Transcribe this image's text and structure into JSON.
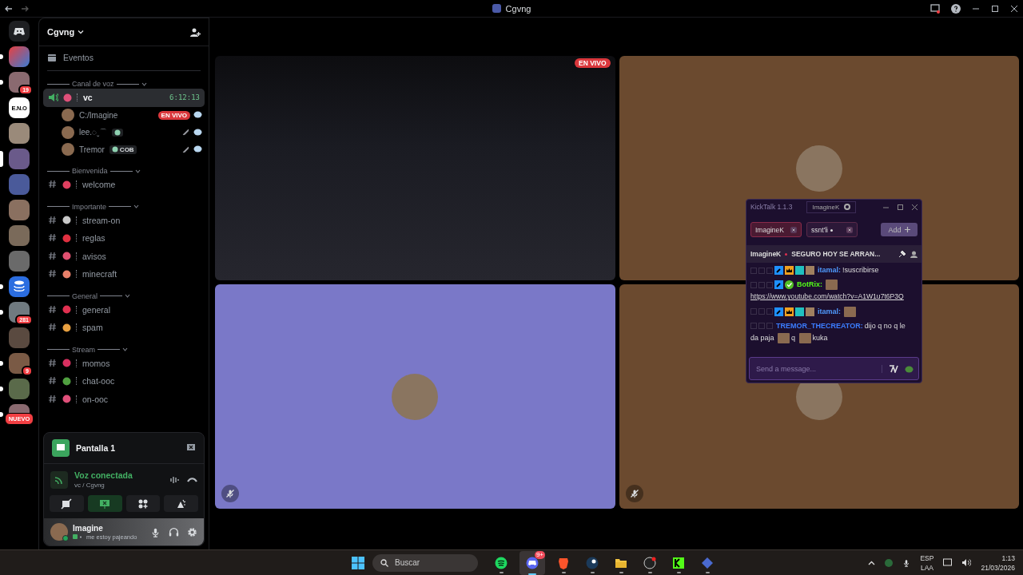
{
  "titlebar": {
    "title": "Cgvng"
  },
  "servers": [
    {
      "kind": "home",
      "selected": false,
      "unread": false
    },
    {
      "kind": "logo",
      "selected": false,
      "unread": true
    },
    {
      "kind": "photo",
      "selected": false,
      "unread": true,
      "badge": "19"
    },
    {
      "kind": "eno",
      "label": "E.N.O",
      "selected": false,
      "unread": false
    },
    {
      "kind": "photo",
      "selected": false,
      "unread": false
    },
    {
      "kind": "photo",
      "selected": true,
      "unread": false
    },
    {
      "kind": "photo",
      "selected": false,
      "unread": false
    },
    {
      "kind": "photo",
      "selected": false,
      "unread": false
    },
    {
      "kind": "photo",
      "selected": false,
      "unread": false
    },
    {
      "kind": "photo",
      "selected": false,
      "unread": false
    },
    {
      "kind": "database",
      "selected": false,
      "unread": true
    },
    {
      "kind": "photo",
      "selected": false,
      "unread": true,
      "badge": "281"
    },
    {
      "kind": "photo",
      "selected": false,
      "unread": false
    },
    {
      "kind": "photo",
      "selected": false,
      "unread": true,
      "badge": "9"
    },
    {
      "kind": "photo",
      "selected": false,
      "unread": true
    },
    {
      "kind": "photo",
      "selected": false,
      "unread": true,
      "badge": "NUEVO"
    }
  ],
  "sidebar": {
    "server_name": "Cgvng",
    "events": "Eventos",
    "categories": [
      {
        "name": "Canal de voz",
        "channels": [
          {
            "kind": "voice",
            "name": "vc",
            "timer": "6:12:13",
            "selected": true,
            "members": [
              {
                "name": "C:/Imagine",
                "live": "EN VIVO",
                "guild_tag": false,
                "muted": false
              },
              {
                "name": "lee.◌ˬ⌒",
                "guild_tag": true,
                "muted": true
              },
              {
                "name": "Tremor",
                "guild_tag": true,
                "tag_text": "COB",
                "muted": true
              }
            ]
          }
        ]
      },
      {
        "name": "Bienvenida",
        "channels": [
          {
            "kind": "text",
            "name": "welcome",
            "selected": false
          }
        ]
      },
      {
        "name": "Importante",
        "channels": [
          {
            "kind": "text",
            "name": "stream-on",
            "selected": false
          },
          {
            "kind": "text",
            "name": "reglas",
            "selected": false
          },
          {
            "kind": "text",
            "name": "avisos",
            "selected": false
          },
          {
            "kind": "text",
            "name": "minecraft",
            "selected": false
          }
        ]
      },
      {
        "name": "General",
        "channels": [
          {
            "kind": "text",
            "name": "general",
            "selected": false
          },
          {
            "kind": "text",
            "name": "spam",
            "selected": false
          }
        ]
      },
      {
        "name": "Stream",
        "channels": [
          {
            "kind": "text",
            "name": "momos",
            "selected": false
          },
          {
            "kind": "text",
            "name": "chat-ooc",
            "selected": false
          },
          {
            "kind": "text",
            "name": "on-ooc",
            "selected": false
          }
        ]
      }
    ]
  },
  "stream_panel": {
    "title": "Pantalla 1"
  },
  "voice_panel": {
    "status": "Voz conectada",
    "location": "vc / Cgvng",
    "buttons": [
      {
        "kind": "camera",
        "on": false
      },
      {
        "kind": "screen",
        "on": true
      },
      {
        "kind": "activities",
        "on": false
      },
      {
        "kind": "soundboard",
        "on": false
      }
    ]
  },
  "user_panel": {
    "name": "Imagine",
    "status": "me estoy pajeando"
  },
  "tiles": [
    {
      "kind": "stream",
      "live": "EN VIVO",
      "muted": false
    },
    {
      "kind": "user",
      "color": "#6b4a2f",
      "muted": false
    },
    {
      "kind": "user",
      "color": "#7a78c8",
      "muted": true
    },
    {
      "kind": "user",
      "color": "#6b4a2f",
      "muted": true
    }
  ],
  "kicktalk": {
    "title": "KickTalk 1.1.3",
    "account": "ImagineK",
    "chat_tabs": [
      {
        "name": "ImagineK",
        "selected": true,
        "live": false
      },
      {
        "name": "ssnt'li",
        "selected": false,
        "live": true
      }
    ],
    "add_label": "Add",
    "pinned": {
      "user": "ImagineK",
      "text": "SEGURO HOY SE ARRAN..."
    },
    "messages": [
      {
        "user": "itamal:",
        "color": "#4f9bff",
        "moderator": true,
        "subscriber": true,
        "verified": false,
        "parts": [
          {
            "kind": "text",
            "text": "!suscribirse"
          }
        ]
      },
      {
        "user": "BotRix:",
        "color": "#53fc18",
        "moderator": true,
        "subscriber": false,
        "verified": true,
        "parts": [
          {
            "kind": "emote"
          },
          {
            "kind": "link",
            "text": "https://www.youtube.com/watch?v=A1W1u7t6P3Q"
          }
        ]
      },
      {
        "user": "itamal:",
        "color": "#4f9bff",
        "moderator": true,
        "subscriber": true,
        "verified": false,
        "parts": [
          {
            "kind": "emote"
          }
        ]
      },
      {
        "user": "TREMOR_THECREATOR:",
        "color": "#3b7dff",
        "moderator": false,
        "subscriber": false,
        "verified": false,
        "parts": [
          {
            "kind": "text",
            "text": "dijo q no q le"
          },
          {
            "kind": "text",
            "text": "da paja"
          },
          {
            "kind": "emote"
          },
          {
            "kind": "text",
            "text": "q"
          },
          {
            "kind": "emote"
          },
          {
            "kind": "text",
            "text": "kuka"
          }
        ]
      }
    ],
    "input": {
      "placeholder": "Send a message..."
    }
  },
  "taskbar": {
    "search": "Buscar",
    "apps": [
      {
        "kind": "spotify",
        "active": false
      },
      {
        "kind": "discord",
        "active": true,
        "badge": "9+"
      },
      {
        "kind": "brave",
        "active": false
      },
      {
        "kind": "steam",
        "active": false
      },
      {
        "kind": "files",
        "active": false
      },
      {
        "kind": "obs",
        "active": false
      },
      {
        "kind": "kick",
        "active": false
      },
      {
        "kind": "stack",
        "active": false
      }
    ],
    "language": "ESP",
    "layout": "LAA",
    "time": "1:13",
    "date": "21/03/2026"
  }
}
